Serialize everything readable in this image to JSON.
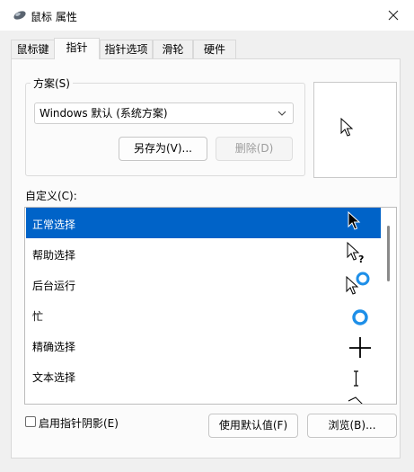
{
  "window": {
    "title": "鼠标 属性",
    "icon": "mouse-icon"
  },
  "tabs": [
    {
      "label": "鼠标键",
      "active": false
    },
    {
      "label": "指针",
      "active": true
    },
    {
      "label": "指针选项",
      "active": false
    },
    {
      "label": "滑轮",
      "active": false
    },
    {
      "label": "硬件",
      "active": false
    }
  ],
  "scheme": {
    "legend": "方案(S)",
    "selected": "Windows 默认 (系统方案)",
    "save_as_label": "另存为(V)...",
    "delete_label": "删除(D)"
  },
  "preview_icon": "arrow-cursor-icon",
  "custom": {
    "label": "自定义(C):",
    "rows": [
      {
        "label": "正常选择",
        "icon": "arrow-cursor-icon",
        "selected": true
      },
      {
        "label": "帮助选择",
        "icon": "help-cursor-icon",
        "selected": false
      },
      {
        "label": "后台运行",
        "icon": "working-in-background-icon",
        "selected": false
      },
      {
        "label": "忙",
        "icon": "busy-ring-icon",
        "selected": false
      },
      {
        "label": "精确选择",
        "icon": "crosshair-icon",
        "selected": false
      },
      {
        "label": "文本选择",
        "icon": "text-ibeam-icon",
        "selected": false
      }
    ]
  },
  "bottom": {
    "shadow_label": "启用指针阴影(E)",
    "shadow_checked": false,
    "default_label": "使用默认值(F)",
    "browse_label": "浏览(B)..."
  },
  "colors": {
    "accent": "#0063c8",
    "panel_bg": "#fbfbfb",
    "window_bg": "#f0f0f0"
  }
}
